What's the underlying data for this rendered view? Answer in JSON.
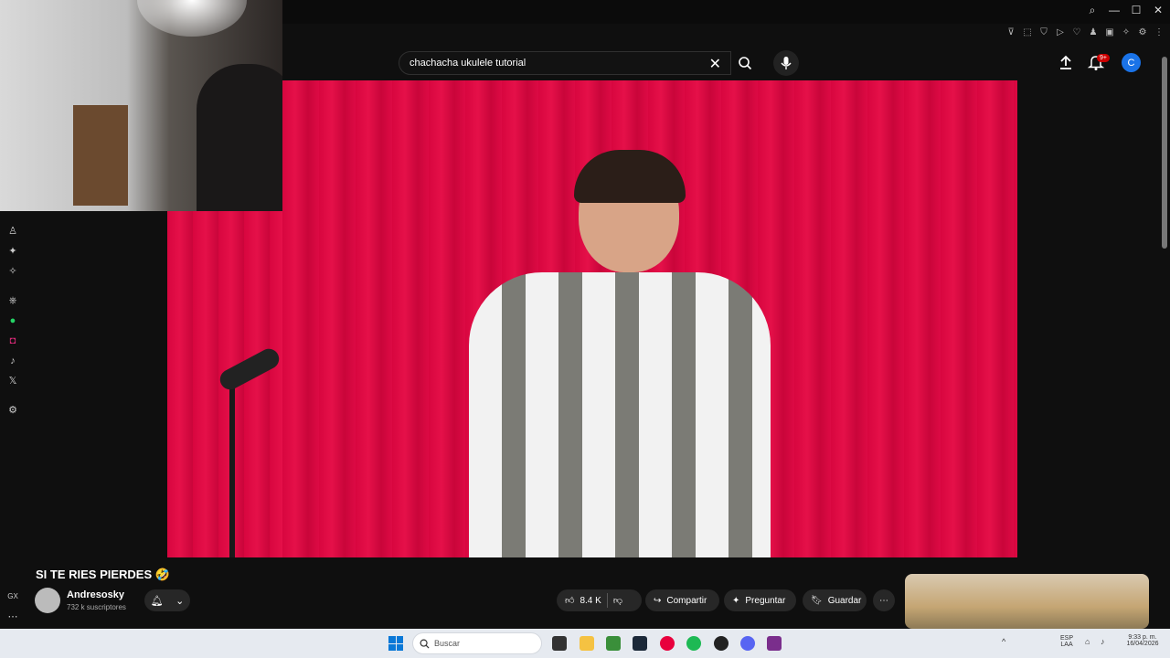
{
  "search": {
    "query": "chachacha ukulele tutorial"
  },
  "header": {
    "notification_count": "9+",
    "avatar_letter": "C"
  },
  "video": {
    "title": "SI TE RIES PIERDES 🤣",
    "channel_name": "Andresosky",
    "subscribers": "732 k suscriptores",
    "likes": "8.4 K",
    "share_label": "Compartir",
    "ask_label": "Preguntar",
    "save_label": "Guardar"
  },
  "taskbar": {
    "search_placeholder": "Buscar",
    "lang_line1": "ESP",
    "lang_line2": "LAA",
    "time": "9:33 p. m.",
    "date": "16/04/2026"
  },
  "left_rail": {
    "label": "GX"
  },
  "colors": {
    "curtain": "#d8063f",
    "accent_blue": "#1a73e8",
    "badge_red": "#cc0000"
  }
}
